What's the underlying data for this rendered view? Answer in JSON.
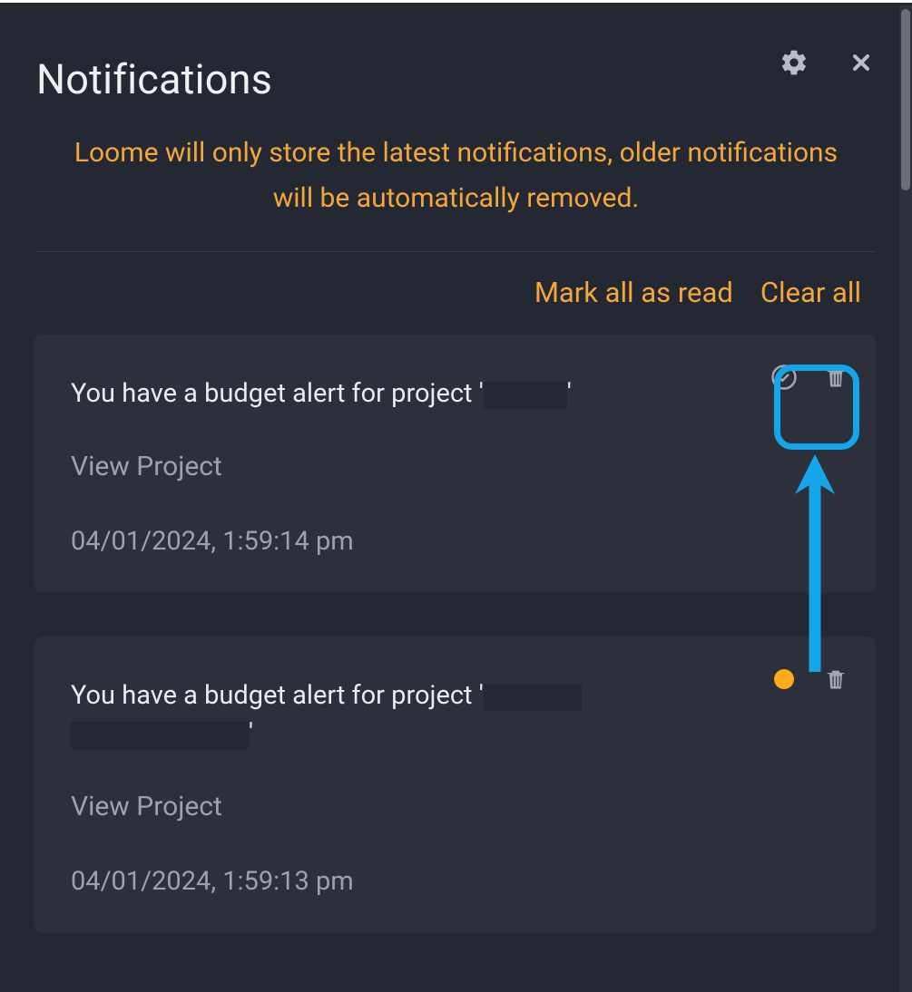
{
  "header": {
    "title": "Notifications"
  },
  "note_text": "Loome will only store the latest notifications, older notifications will be automatically removed.",
  "actions": {
    "mark_all_read": "Mark all as read",
    "clear_all": "Clear all"
  },
  "cards": [
    {
      "message_prefix": "You have a budget alert for project '",
      "message_suffix": "'",
      "view_label": "View Project",
      "timestamp": "04/01/2024, 1:59:14 pm",
      "read": true
    },
    {
      "message_prefix": "You have a budget alert for project '",
      "message_suffix": "'",
      "view_label": "View Project",
      "timestamp": "04/01/2024, 1:59:13 pm",
      "read": false
    }
  ]
}
